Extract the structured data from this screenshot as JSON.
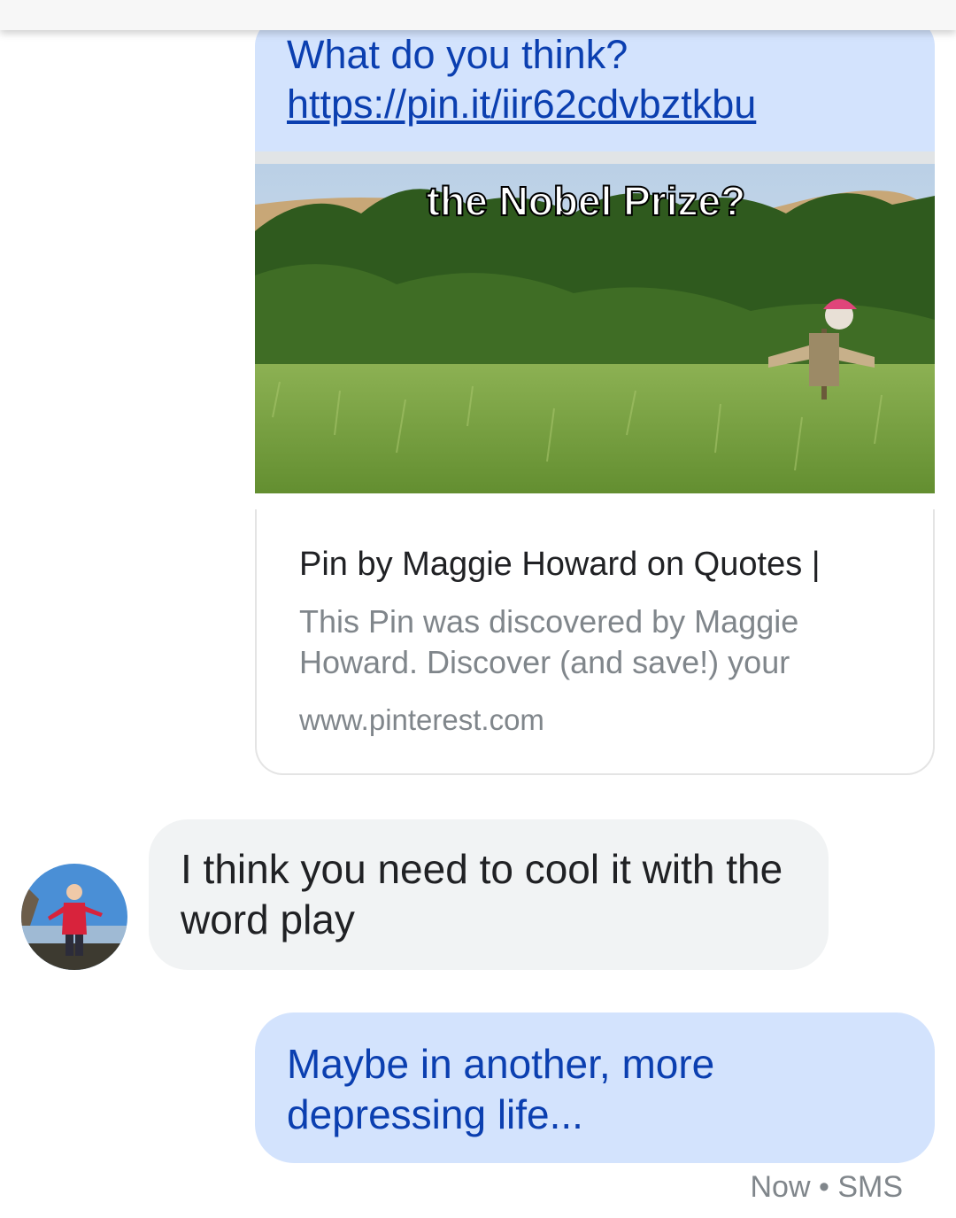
{
  "messages": {
    "outgoing_1": {
      "text": "What do you think?",
      "link": "https://pin.it/iir62cdvbztkbu",
      "preview": {
        "image_caption_top": "the Nobel Prize?",
        "title": "Pin by Maggie Howard on Quotes |",
        "description": "This Pin was discovered by Maggie Howard. Discover (and save!) your",
        "domain": "www.pinterest.com"
      }
    },
    "incoming_1": {
      "text": "I think you need to cool it with the word play"
    },
    "outgoing_2": {
      "text": "Maybe in another, more depressing life..."
    },
    "status": "Now • SMS"
  },
  "colors": {
    "outgoing_bubble": "#d3e3fd",
    "outgoing_text": "#0b3fb0",
    "incoming_bubble": "#f1f3f4",
    "secondary_text": "#80868b"
  }
}
